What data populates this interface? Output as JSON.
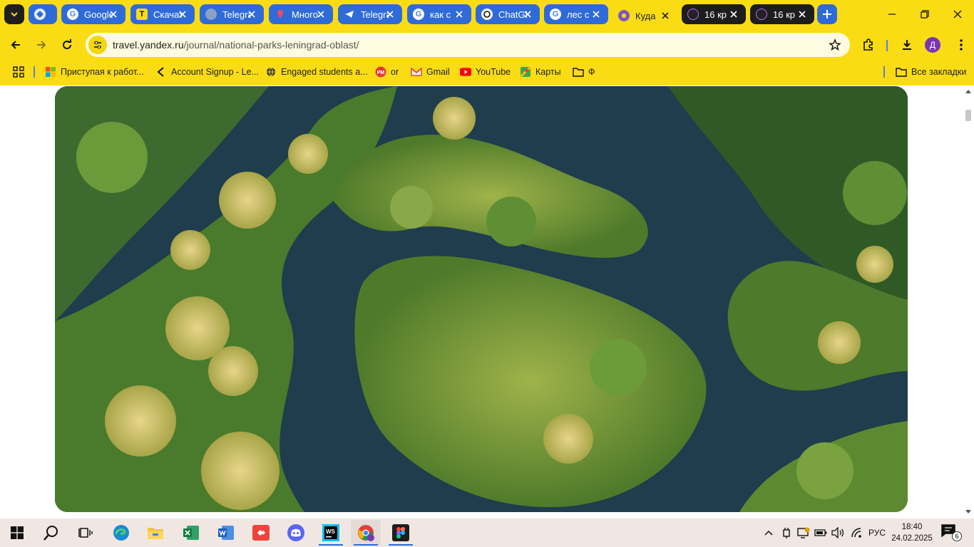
{
  "browser": {
    "tabs": [
      {
        "title": "Google",
        "favicon": "google-icon",
        "state": "inactive"
      },
      {
        "title": "Скачать",
        "favicon": "t-icon",
        "state": "inactive"
      },
      {
        "title": "Telegram",
        "favicon": "globe-icon",
        "state": "inactive"
      },
      {
        "title": "Много",
        "favicon": "pin-icon",
        "state": "inactive"
      },
      {
        "title": "Telegram",
        "favicon": "telegram-icon",
        "state": "inactive"
      },
      {
        "title": "как с",
        "favicon": "google-icon",
        "state": "inactive"
      },
      {
        "title": "ChatGPT",
        "favicon": "chatgpt-icon",
        "state": "inactive"
      },
      {
        "title": "лес с",
        "favicon": "google-icon",
        "state": "inactive"
      },
      {
        "title": "Куда",
        "favicon": "yandex-travel-icon",
        "state": "active"
      },
      {
        "title": "16 кр",
        "favicon": "app-icon",
        "state": "inactive"
      },
      {
        "title": "16 кр",
        "favicon": "app-icon",
        "state": "inactive"
      }
    ],
    "url": {
      "host": "travel.yandex.ru",
      "path": "/journal/national-parks-leningrad-oblast/"
    },
    "profile_initial": "Д",
    "bookmarks": [
      {
        "label": "Приступая к работ...",
        "icon": "windows-color-icon"
      },
      {
        "label": "Account Signup - Le...",
        "icon": "arrow-icon"
      },
      {
        "label": "Engaged students a...",
        "icon": "globe-icon"
      },
      {
        "label": "or",
        "icon": "pm-icon"
      },
      {
        "label": "Gmail",
        "icon": "gmail-icon"
      },
      {
        "label": "YouTube",
        "icon": "youtube-icon"
      },
      {
        "label": "Карты",
        "icon": "maps-icon"
      },
      {
        "label": "Ф",
        "icon": "folder-icon"
      }
    ],
    "all_bookmarks_label": "Все закладки"
  },
  "taskbar": {
    "apps": [
      "start-icon",
      "search-icon",
      "task-view-icon",
      "edge-icon",
      "file-explorer-icon",
      "excel-icon",
      "word-icon",
      "anydesk-icon",
      "discord-icon",
      "webstorm-icon",
      "chrome-icon",
      "figma-icon"
    ],
    "language": "РУС",
    "time": "18:40",
    "date": "24.02.2025",
    "notification_count": "6"
  },
  "colors": {
    "theme_yellow": "#f9dc14",
    "tab_blue": "#2f6bd8",
    "taskbar_bg": "#f0e7e3"
  }
}
